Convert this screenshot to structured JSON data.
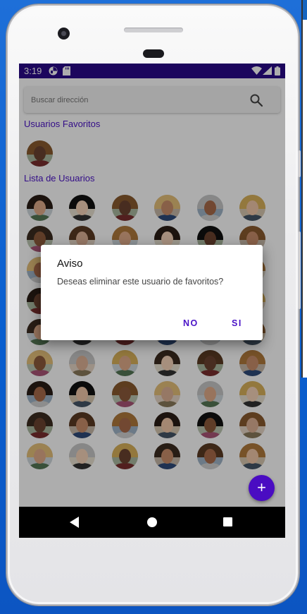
{
  "status_bar": {
    "time": "3:19",
    "bg_color": "#2a0a8a"
  },
  "search": {
    "placeholder": "Buscar dirección",
    "value": "",
    "icon": "search-icon"
  },
  "favorites": {
    "title": "Usuarios Favoritos",
    "count_shown": 1
  },
  "users": {
    "title": "Lista de Usuarios",
    "rows": 9,
    "cols": 6
  },
  "dialog": {
    "title": "Aviso",
    "message": "Deseas eliminar este usuario de favoritos?",
    "negative_label": "NO",
    "positive_label": "SI"
  },
  "fab": {
    "label": "+",
    "icon": "add-icon",
    "color": "#4a0cc2"
  },
  "nav": {
    "back_icon": "back-icon",
    "home_icon": "home-icon",
    "recents_icon": "recents-icon"
  },
  "colors": {
    "accent": "#4a13c7",
    "primary_dark": "#2a0a8a"
  }
}
